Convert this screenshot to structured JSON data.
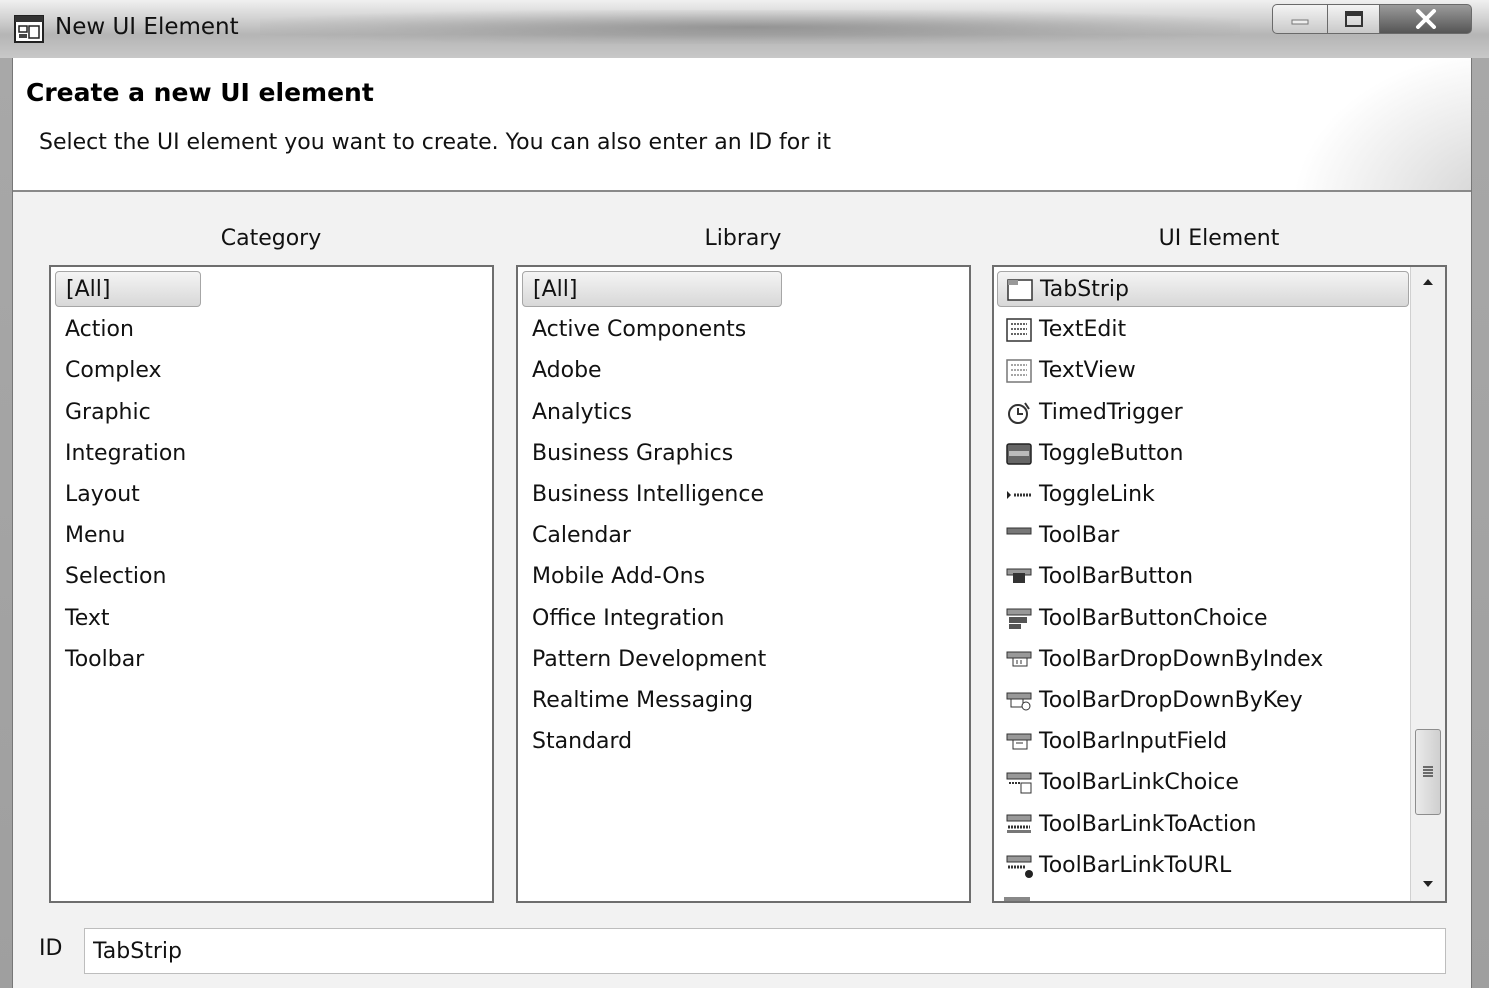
{
  "window": {
    "title": "New UI Element"
  },
  "header": {
    "title": "Create a new UI element",
    "description": "Select the UI element you want to create. You can also enter an ID for it"
  },
  "columns": {
    "category_label": "Category",
    "library_label": "Library",
    "element_label": "UI Element"
  },
  "categories": [
    "[All]",
    "Action",
    "Complex",
    "Graphic",
    "Integration",
    "Layout",
    "Menu",
    "Selection",
    "Text",
    "Toolbar"
  ],
  "libraries": [
    "[All]",
    "Active Components",
    "Adobe",
    "Analytics",
    "Business Graphics",
    "Business Intelligence",
    "Calendar",
    "Mobile Add-Ons",
    "Office Integration",
    "Pattern Development",
    "Realtime Messaging",
    "Standard"
  ],
  "ui_elements": [
    {
      "label": "TabStrip",
      "icon": "tabstrip-icon"
    },
    {
      "label": "TextEdit",
      "icon": "textedit-icon"
    },
    {
      "label": "TextView",
      "icon": "textview-icon"
    },
    {
      "label": "TimedTrigger",
      "icon": "timedtrigger-icon"
    },
    {
      "label": "ToggleButton",
      "icon": "togglebutton-icon"
    },
    {
      "label": "ToggleLink",
      "icon": "togglelink-icon"
    },
    {
      "label": "ToolBar",
      "icon": "toolbar-icon"
    },
    {
      "label": "ToolBarButton",
      "icon": "toolbarbutton-icon"
    },
    {
      "label": "ToolBarButtonChoice",
      "icon": "toolbarbuttonchoice-icon"
    },
    {
      "label": "ToolBarDropDownByIndex",
      "icon": "toolbardropdownbyindex-icon"
    },
    {
      "label": "ToolBarDropDownByKey",
      "icon": "toolbardropdownbykey-icon"
    },
    {
      "label": "ToolBarInputField",
      "icon": "toolbarinputfield-icon"
    },
    {
      "label": "ToolBarLinkChoice",
      "icon": "toolbarlinkchoice-icon"
    },
    {
      "label": "ToolBarLinkToAction",
      "icon": "toolbarlinktoaction-icon"
    },
    {
      "label": "ToolBarLinkToURL",
      "icon": "toolbarlinktourl-icon"
    }
  ],
  "id_field": {
    "label": "ID",
    "value": "TabStrip"
  }
}
